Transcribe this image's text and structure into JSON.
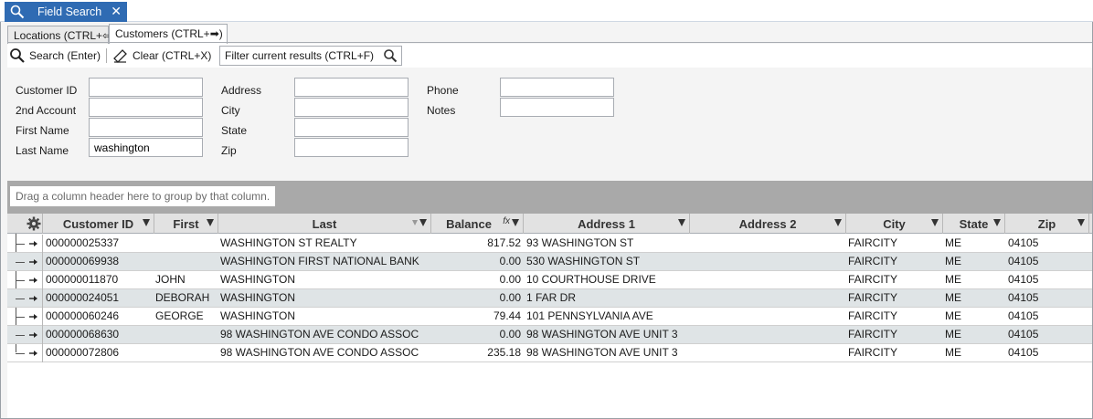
{
  "doc_tab": {
    "title": "Field Search",
    "close": "✕",
    "icon": "magnifier-icon"
  },
  "subtabs": [
    {
      "label": "Locations (CTRL+⇦)",
      "active": false
    },
    {
      "label": "Customers (CTRL+➡)",
      "active": true
    }
  ],
  "toolbar": {
    "search_label": "Search (Enter)",
    "clear_label": "Clear (CTRL+X)",
    "filter_placeholder": "Filter current results (CTRL+F)"
  },
  "form": {
    "customer_id": {
      "label": "Customer ID",
      "value": ""
    },
    "second_account": {
      "label": "2nd Account",
      "value": ""
    },
    "first_name": {
      "label": "First Name",
      "value": ""
    },
    "last_name": {
      "label": "Last Name",
      "value": "washington"
    },
    "address": {
      "label": "Address",
      "value": ""
    },
    "city": {
      "label": "City",
      "value": ""
    },
    "state": {
      "label": "State",
      "value": ""
    },
    "zip": {
      "label": "Zip",
      "value": ""
    },
    "phone": {
      "label": "Phone",
      "value": ""
    },
    "notes": {
      "label": "Notes",
      "value": ""
    }
  },
  "groupby_hint": "Drag a column header here to group by that column.",
  "grid": {
    "headers": {
      "customer_id": "Customer ID",
      "first": "First",
      "last": "Last",
      "balance": "Balance",
      "address1": "Address 1",
      "address2": "Address 2",
      "city": "City",
      "state": "State",
      "zip": "Zip"
    },
    "rows": [
      {
        "customer_id": "000000025337",
        "first": "",
        "last": "WASHINGTON ST REALTY",
        "balance": "817.52",
        "address1": "93 WASHINGTON ST",
        "address2": "",
        "city": "FAIRCITY",
        "state": "ME",
        "zip": "04105"
      },
      {
        "customer_id": "000000069938",
        "first": "",
        "last": "WASHINGTON FIRST NATIONAL BANK",
        "balance": "0.00",
        "address1": "530 WASHINGTON ST",
        "address2": "",
        "city": "FAIRCITY",
        "state": "ME",
        "zip": "04105"
      },
      {
        "customer_id": "000000011870",
        "first": "JOHN",
        "last": "WASHINGTON",
        "balance": "0.00",
        "address1": "10  COURTHOUSE DRIVE",
        "address2": "",
        "city": "FAIRCITY",
        "state": "ME",
        "zip": "04105"
      },
      {
        "customer_id": "000000024051",
        "first": "DEBORAH",
        "last": "WASHINGTON",
        "balance": "0.00",
        "address1": "1 FAR DR",
        "address2": "",
        "city": "FAIRCITY",
        "state": "ME",
        "zip": "04105"
      },
      {
        "customer_id": "000000060246",
        "first": "GEORGE",
        "last": "WASHINGTON",
        "balance": "79.44",
        "address1": "101 PENNSYLVANIA AVE",
        "address2": "",
        "city": "FAIRCITY",
        "state": "ME",
        "zip": "04105"
      },
      {
        "customer_id": "000000068630",
        "first": "",
        "last": "98 WASHINGTON AVE CONDO ASSOC",
        "balance": "0.00",
        "address1": "98 WASHINGTON AVE UNIT 3",
        "address2": "",
        "city": "FAIRCITY",
        "state": "ME",
        "zip": "04105"
      },
      {
        "customer_id": "000000072806",
        "first": "",
        "last": "98 WASHINGTON AVE CONDO ASSOC",
        "balance": "235.18",
        "address1": "98 WASHINGTON AVE UNIT 3",
        "address2": "",
        "city": "FAIRCITY",
        "state": "ME",
        "zip": "04105"
      }
    ]
  },
  "colors": {
    "tab_blue": "#2f6bb3",
    "alt_row": "#dfe4e6",
    "groupby_gray": "#a9a9a9"
  }
}
